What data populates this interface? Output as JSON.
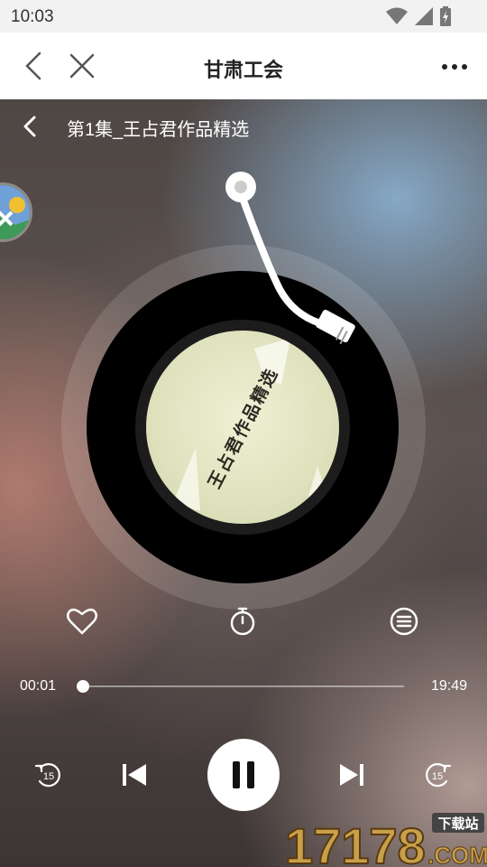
{
  "status_bar": {
    "time": "10:03",
    "icons": [
      "wifi-icon",
      "signal-icon",
      "battery-icon"
    ]
  },
  "header": {
    "title": "甘肃工会",
    "back_icon": "chevron-left-icon",
    "close_icon": "close-icon",
    "more_icon": "more-dots-icon"
  },
  "player": {
    "episode_title": "第1集_王占君作品精选",
    "cover_text": "王占君作品精选",
    "current_time": "00:01",
    "total_time": "19:49",
    "progress": 0.001,
    "is_playing": true,
    "controls": {
      "favorite": "heart-icon",
      "timer": "timer-icon",
      "playlist": "playlist-icon",
      "rewind": "rewind-15-icon",
      "previous": "previous-icon",
      "pause": "pause-icon",
      "next": "next-icon",
      "forward": "forward-15-icon"
    },
    "skip_seconds": "15"
  },
  "watermark": {
    "number": "17178",
    "tag": "下载站",
    "suffix": ".COM"
  },
  "colors": {
    "accent": "#ffffff",
    "header_bg": "#ffffff",
    "status_bg": "#f2f2f2"
  }
}
